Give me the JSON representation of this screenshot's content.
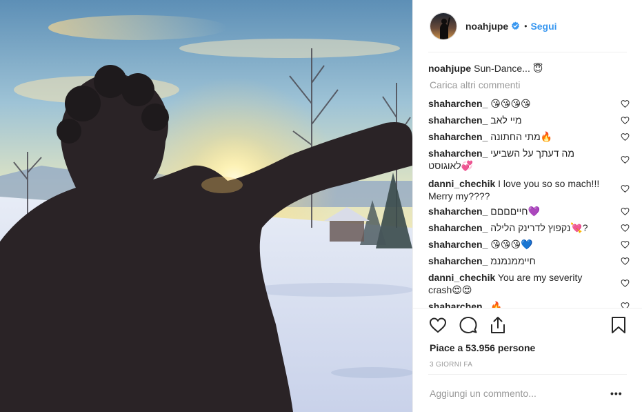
{
  "photo": {
    "alt": "",
    "kind": "sunset-backlit-person"
  },
  "header": {
    "username": "noahjupe",
    "separator": "•",
    "follow_label": "Segui"
  },
  "caption": {
    "username": "noahjupe",
    "text": "Sun-Dance... 😇"
  },
  "load_more_label": "Carica altri commenti",
  "comments": [
    {
      "username": "shaharchen_",
      "text": "😘😘😘😘"
    },
    {
      "username": "shaharchen_",
      "text": "מיי לאב"
    },
    {
      "username": "shaharchen_",
      "text": "מתי החתונה🔥"
    },
    {
      "username": "shaharchen_",
      "text": "מה דעתך על השביעי",
      "text2": "לאוגוסט💞"
    },
    {
      "username": "danni_chechik",
      "text": "I love you so so mach!!!",
      "text2": "Merry my????"
    },
    {
      "username": "shaharchen_",
      "text": "חייםםםם💜"
    },
    {
      "username": "shaharchen_",
      "text": "נקפוץ לדרינק הלילה💘?"
    },
    {
      "username": "shaharchen_",
      "text": "😘😘😘💙"
    },
    {
      "username": "shaharchen_",
      "text": "חייממנמנמ"
    },
    {
      "username": "danni_chechik",
      "text": "You are my severity",
      "text2": "crash😍😍"
    },
    {
      "username": "shaharchen_",
      "text": "🔥"
    }
  ],
  "likes_label": "Piace a 53.956 persone",
  "time_label": "3 GIORNI FA",
  "add_comment_placeholder": "Aggiungi un commento...",
  "more_options_label": "•••",
  "colors": {
    "link": "#3897f0",
    "muted": "#999999",
    "text": "#262626",
    "verified": "#3897f0"
  }
}
